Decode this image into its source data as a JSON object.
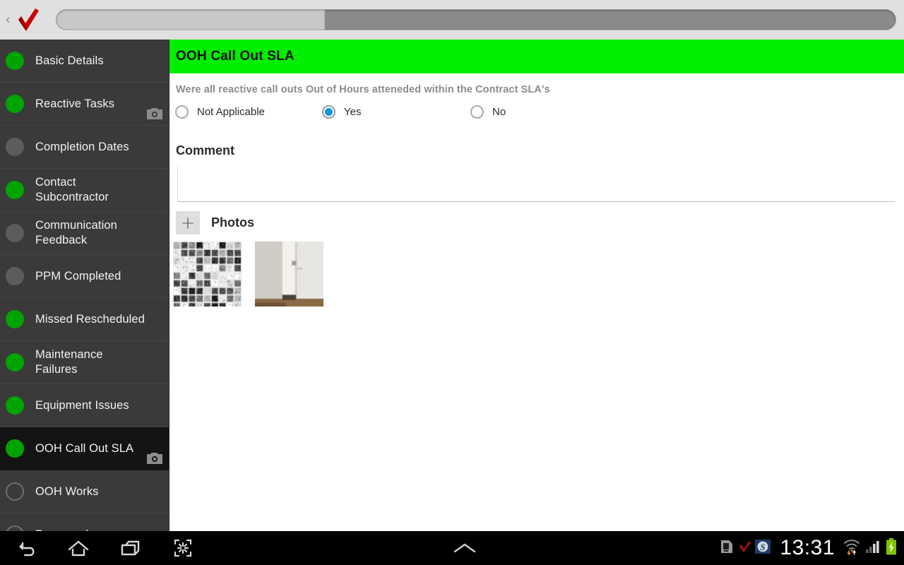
{
  "topbar": {
    "back_icon": "chevron-left-icon",
    "logo_icon": "red-checkmark-logo",
    "back_label": "‹",
    "progress_percent": 32
  },
  "sidebar": {
    "items": [
      {
        "label": "Basic Details",
        "status": "green",
        "camera": false,
        "selected": false
      },
      {
        "label": "Reactive Tasks",
        "status": "green",
        "camera": true,
        "selected": false
      },
      {
        "label": "Completion Dates",
        "status": "gray",
        "camera": false,
        "selected": false
      },
      {
        "label": "Contact Subcontractor",
        "status": "green",
        "camera": false,
        "selected": false
      },
      {
        "label": "Communication Feedback",
        "status": "gray",
        "camera": false,
        "selected": false
      },
      {
        "label": "PPM Completed",
        "status": "gray",
        "camera": false,
        "selected": false
      },
      {
        "label": "Missed Rescheduled",
        "status": "green",
        "camera": false,
        "selected": false
      },
      {
        "label": "Maintenance Failures",
        "status": "green",
        "camera": false,
        "selected": false
      },
      {
        "label": "Equipment Issues",
        "status": "green",
        "camera": false,
        "selected": false
      },
      {
        "label": "OOH Call Out SLA",
        "status": "green",
        "camera": true,
        "selected": true
      },
      {
        "label": "OOH Works",
        "status": "hollow",
        "camera": false,
        "selected": false
      },
      {
        "label": "Paperwork",
        "status": "hollow",
        "camera": false,
        "selected": false
      }
    ]
  },
  "main": {
    "section_title": "OOH Call Out SLA",
    "question": "Were all reactive call outs Out of Hours atteneded within the Contract SLA's",
    "radio_options": [
      {
        "label": "Not Applicable",
        "checked": false
      },
      {
        "label": "Yes",
        "checked": true
      },
      {
        "label": "No",
        "checked": false
      }
    ],
    "comment": {
      "title": "Comment",
      "value": "",
      "placeholder": ""
    },
    "photos": {
      "add_label": "+",
      "title": "Photos",
      "thumbnails": [
        {
          "name": "mosaic-tile-wall-photo",
          "width": 97,
          "height": 92
        },
        {
          "name": "white-door-interior-photo",
          "width": 97,
          "height": 92
        }
      ]
    }
  },
  "navbar": {
    "buttons": [
      {
        "name": "back-button",
        "icon": "back-arrow-icon"
      },
      {
        "name": "home-button",
        "icon": "home-icon"
      },
      {
        "name": "recent-apps-button",
        "icon": "recent-apps-icon"
      },
      {
        "name": "screenshot-button",
        "icon": "shrink-screen-icon"
      },
      {
        "name": "expand-button",
        "icon": "chevron-up-icon"
      }
    ],
    "status": {
      "clock": "13:31",
      "icons": [
        {
          "name": "sd-card-icon"
        },
        {
          "name": "red-check-notification-icon"
        },
        {
          "name": "s-app-notification-icon",
          "label": "S"
        },
        {
          "name": "wifi-icon"
        },
        {
          "name": "cellular-signal-icon",
          "bars_filled": 2,
          "bars_total": 4
        },
        {
          "name": "battery-charging-icon"
        }
      ]
    }
  },
  "colors": {
    "header_green": "#00ef00",
    "status_green": "#00a300",
    "radio_blue": "#0d9ad6",
    "sidebar_bg": "#3a3a3a",
    "sidebar_selected_bg": "#141414",
    "topbar_bg": "#e0e0e0",
    "logo_red": "#cc0000"
  }
}
